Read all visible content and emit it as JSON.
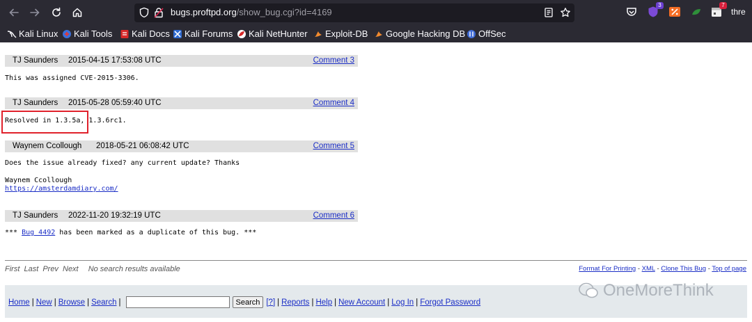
{
  "browser": {
    "url_host": "bugs.proftpd.org",
    "url_path": "/show_bug.cgi?id=4169",
    "extensions": [
      {
        "name": "pocket-icon",
        "badge": ""
      },
      {
        "name": "purple-shield-extension-icon",
        "badge": "3"
      },
      {
        "name": "orange-percent-extension-icon",
        "badge": ""
      },
      {
        "name": "green-extension-icon",
        "badge": ""
      },
      {
        "name": "calendar-extension-icon",
        "badge": "7"
      }
    ],
    "overflow_label": "thre"
  },
  "bookmarks": [
    "Kali Linux",
    "Kali Tools",
    "Kali Docs",
    "Kali Forums",
    "Kali NetHunter",
    "Exploit-DB",
    "Google Hacking DB",
    "OffSec"
  ],
  "comments": [
    {
      "author": "TJ Saunders",
      "date": "2015-04-15 17:53:08 UTC",
      "label": "Comment 3",
      "text": "This was assigned CVE-2015-3306."
    },
    {
      "author": "TJ Saunders",
      "date": "2015-05-28 05:59:40 UTC",
      "label": "Comment 4",
      "text_highlighted": "Resolved in 1.3.5a,",
      "text_rest": " 1.3.6rc1."
    },
    {
      "author": "Waynem Ccollough",
      "date": "2018-05-21 06:08:42 UTC",
      "label": "Comment 5",
      "line1": "Does the issue already fixed? any current update? Thanks",
      "line2": "Waynem Ccollough",
      "link": "https://amsterdamdiary.com/"
    },
    {
      "author": "TJ Saunders",
      "date": "2022-11-20 19:32:19 UTC",
      "label": "Comment 6",
      "prefix": "*** ",
      "bug_link": "Bug 4492",
      "suffix": " has been marked as a duplicate of this bug. ***"
    }
  ],
  "bottom_nav": {
    "first": "First",
    "last": "Last",
    "prev": "Prev",
    "next": "Next",
    "status": "No search results available"
  },
  "right_links": {
    "format_printing": "Format For Printing",
    "xml": "XML",
    "clone": "Clone This Bug",
    "top": "Top of page",
    "sep": " - "
  },
  "footer": {
    "home": "Home",
    "new": "New",
    "browse": "Browse",
    "search": "Search",
    "search_button": "Search",
    "help_q": "[?]",
    "reports": "Reports",
    "help": "Help",
    "new_account": "New Account",
    "login": "Log In",
    "forgot": "Forgot Password"
  },
  "watermark": "OneMoreThink",
  "colors": {
    "link": "#1a2dc6",
    "highlight": "#e0212b",
    "comment_header": "#e0e0e0",
    "footer_bg": "#e4e9ec"
  }
}
